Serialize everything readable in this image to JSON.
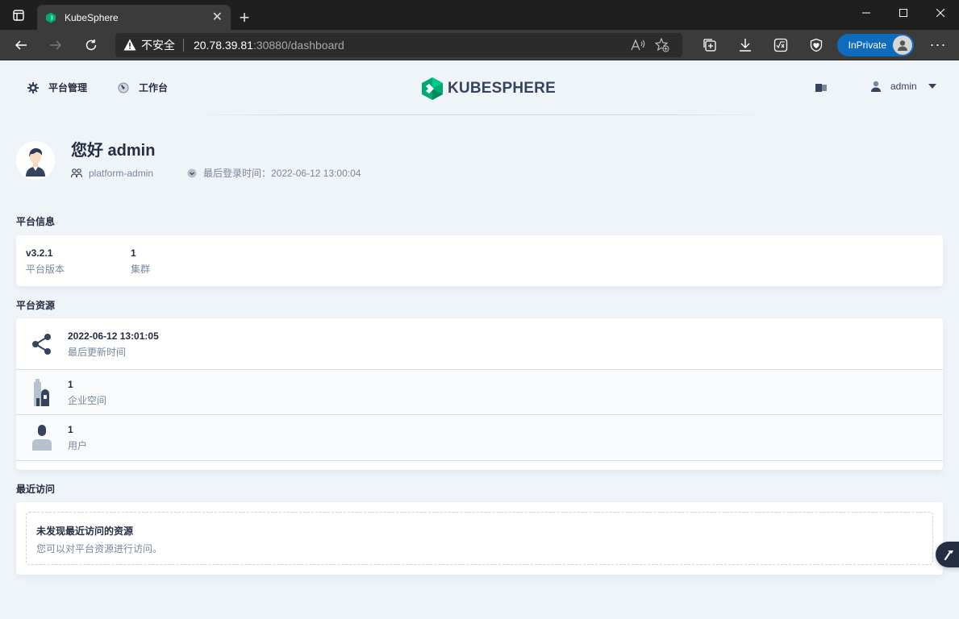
{
  "browser": {
    "tab_title": "KubeSphere",
    "address_insecure": "不安全",
    "address_host": "20.78.39.81",
    "address_path": ":30880/dashboard",
    "inprivate_label": "InPrivate"
  },
  "nav": {
    "platform_mgmt": "平台管理",
    "workbench": "工作台",
    "logo_text": "KUBESPHERE",
    "username": "admin"
  },
  "greeting": {
    "hello": "您好 admin",
    "role": "platform-admin",
    "last_login": "最后登录时间：2022-06-12 13:00:04"
  },
  "platform_info": {
    "title": "平台信息",
    "items": [
      {
        "value": "v3.2.1",
        "label": "平台版本"
      },
      {
        "value": "1",
        "label": "集群"
      }
    ]
  },
  "platform_resources": {
    "title": "平台资源",
    "items": [
      {
        "value": "2022-06-12 13:01:05",
        "label": "最后更新时间",
        "icon": "share-nodes-icon"
      },
      {
        "value": "1",
        "label": "企业空间",
        "icon": "enterprise-workspace-icon"
      },
      {
        "value": "1",
        "label": "用户",
        "icon": "user-icon"
      }
    ]
  },
  "recent": {
    "title": "最近访问",
    "empty_title": "未发现最近访问的资源",
    "empty_desc": "您可以对平台资源进行访问。"
  },
  "colors": {
    "brand_green": "#00aa72",
    "text_primary": "#242e42",
    "text_secondary": "#79879c",
    "page_bg": "#eff4f9",
    "inprivate_blue": "#0f6cbd"
  }
}
